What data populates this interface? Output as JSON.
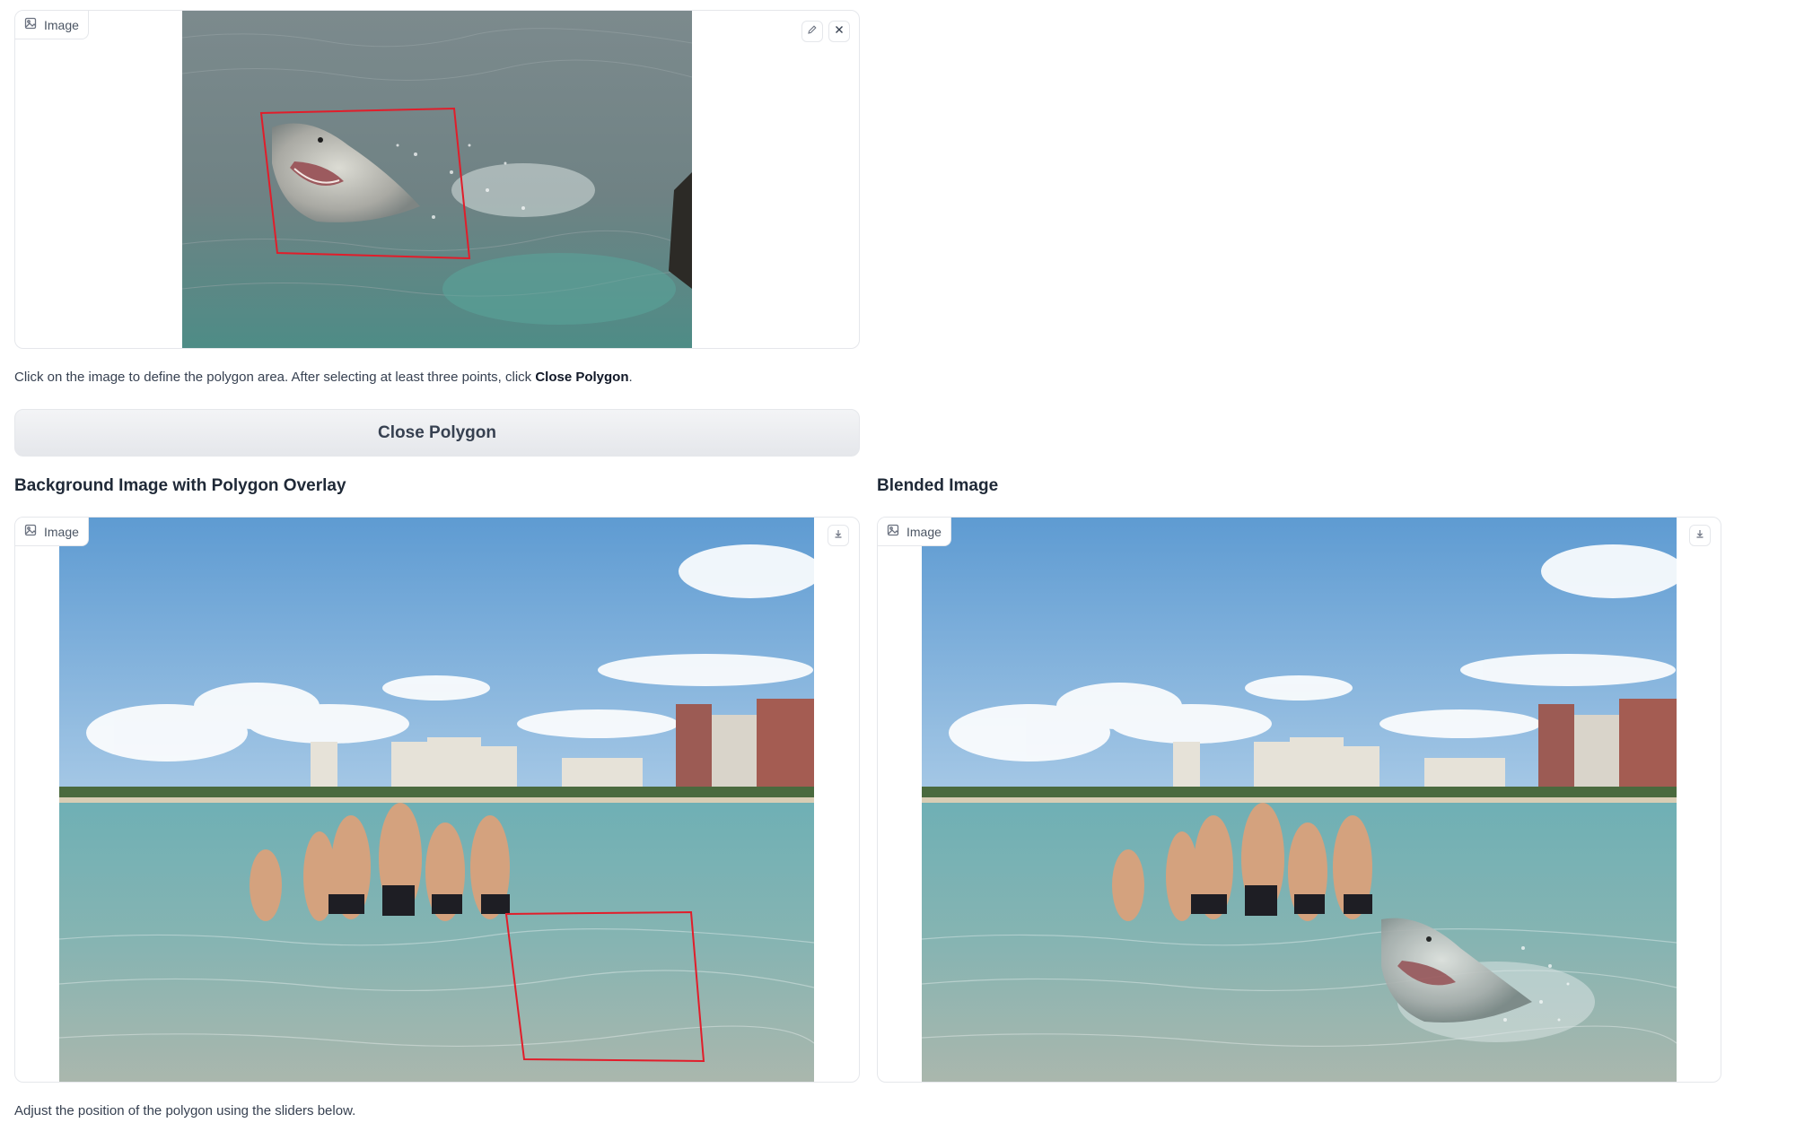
{
  "source_panel": {
    "badge_label": "Image",
    "edit_icon": "pencil-icon",
    "clear_icon": "close-icon"
  },
  "instruction": {
    "text_before": "Click on the image to define the polygon area. After selecting at least three points, click ",
    "text_bold": "Close Polygon",
    "text_after": "."
  },
  "close_polygon_button": {
    "label": "Close Polygon"
  },
  "overlay_section": {
    "title": "Background Image with Polygon Overlay",
    "badge_label": "Image",
    "download_icon": "download-icon"
  },
  "blended_section": {
    "title": "Blended Image",
    "badge_label": "Image",
    "download_icon": "download-icon"
  },
  "slider_instruction": {
    "text": "Adjust the position of the polygon using the sliders below."
  },
  "colors": {
    "polygon_stroke": "#e11d2a",
    "border": "#e5e7eb",
    "button_bg": "#e5e7eb"
  }
}
